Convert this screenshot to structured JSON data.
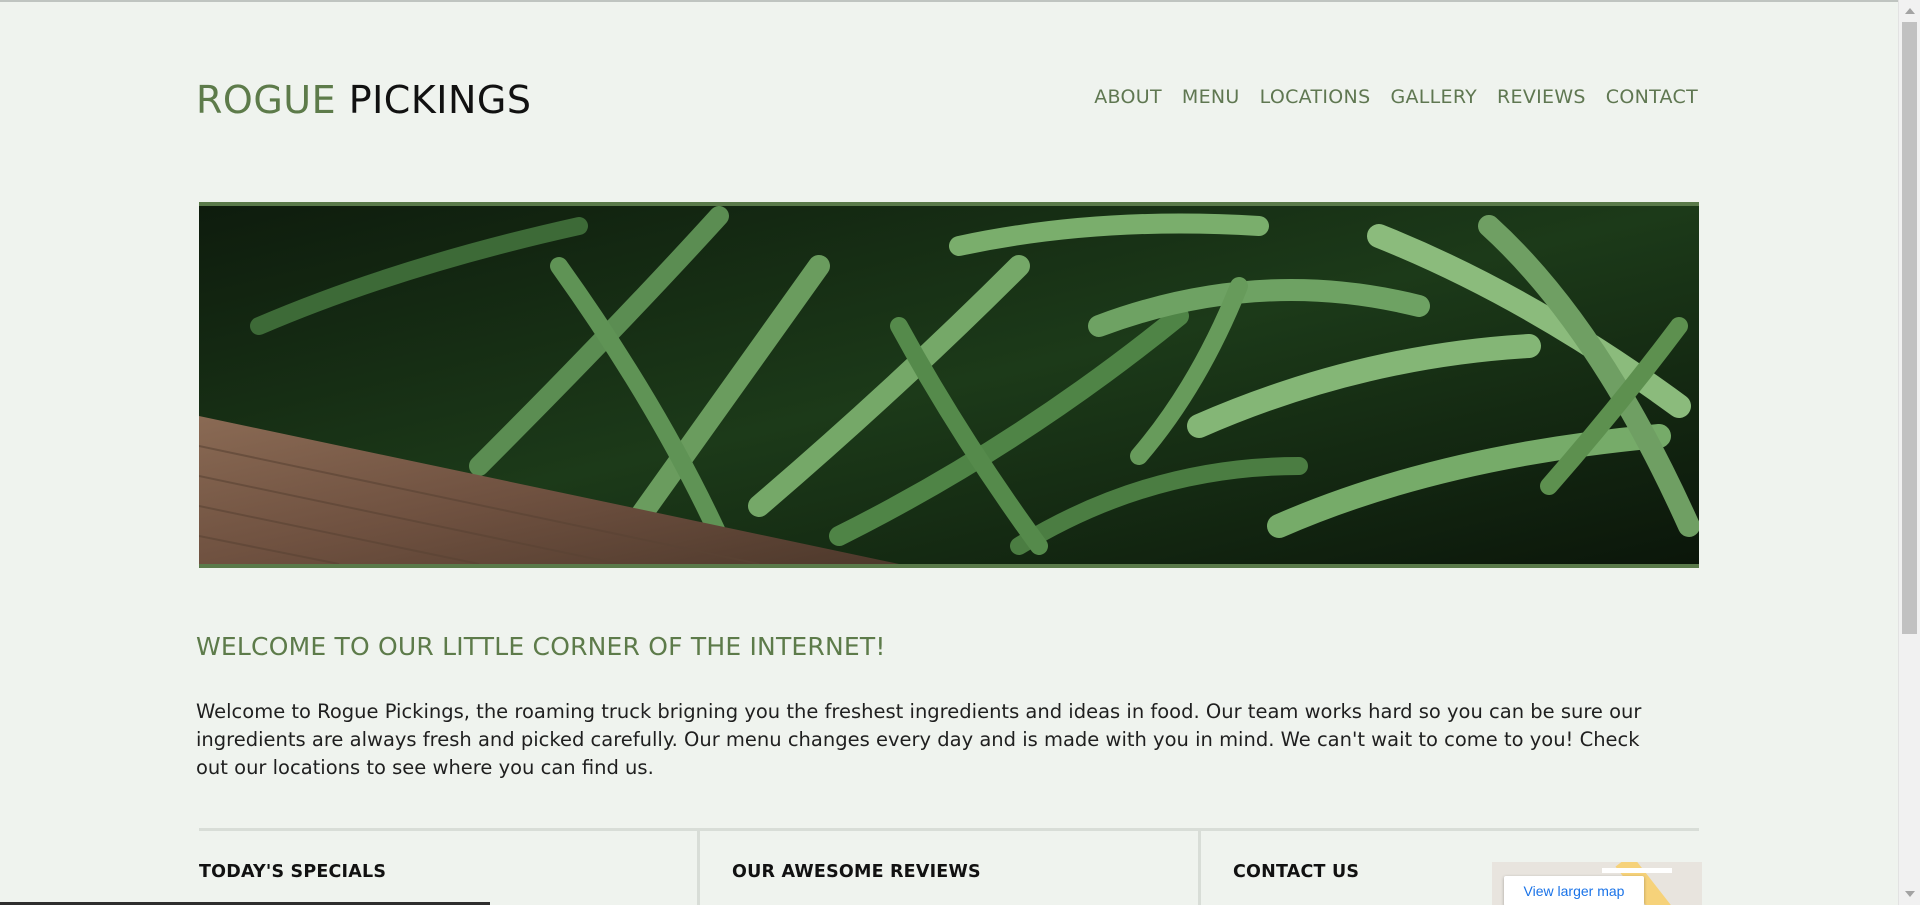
{
  "header": {
    "logo_part1": "ROGUE",
    "logo_part2": "PICKINGS",
    "nav": [
      "ABOUT",
      "MENU",
      "LOCATIONS",
      "GALLERY",
      "REVIEWS",
      "CONTACT"
    ]
  },
  "hero": {
    "image": "green-beans-photo"
  },
  "welcome": {
    "title": "WELCOME TO OUR LITTLE CORNER OF THE INTERNET!",
    "text": "Welcome to Rogue Pickings, the roaming truck brigning you the freshest ingredients and ideas in food. Our team works hard so you can be sure our ingredients are always fresh and picked carefully. Our menu changes every day and is made with you in mind. We can't wait to come to you! Check out our locations to see where you can find us."
  },
  "sections": {
    "specials": "TODAY'S SPECIALS",
    "reviews": "OUR AWESOME REVIEWS",
    "contact": "CONTACT US"
  },
  "map": {
    "link_label": "View larger map"
  },
  "colors": {
    "accent": "#5d7b4a",
    "background": "#eff3ee",
    "border": "#5a7a4a"
  }
}
